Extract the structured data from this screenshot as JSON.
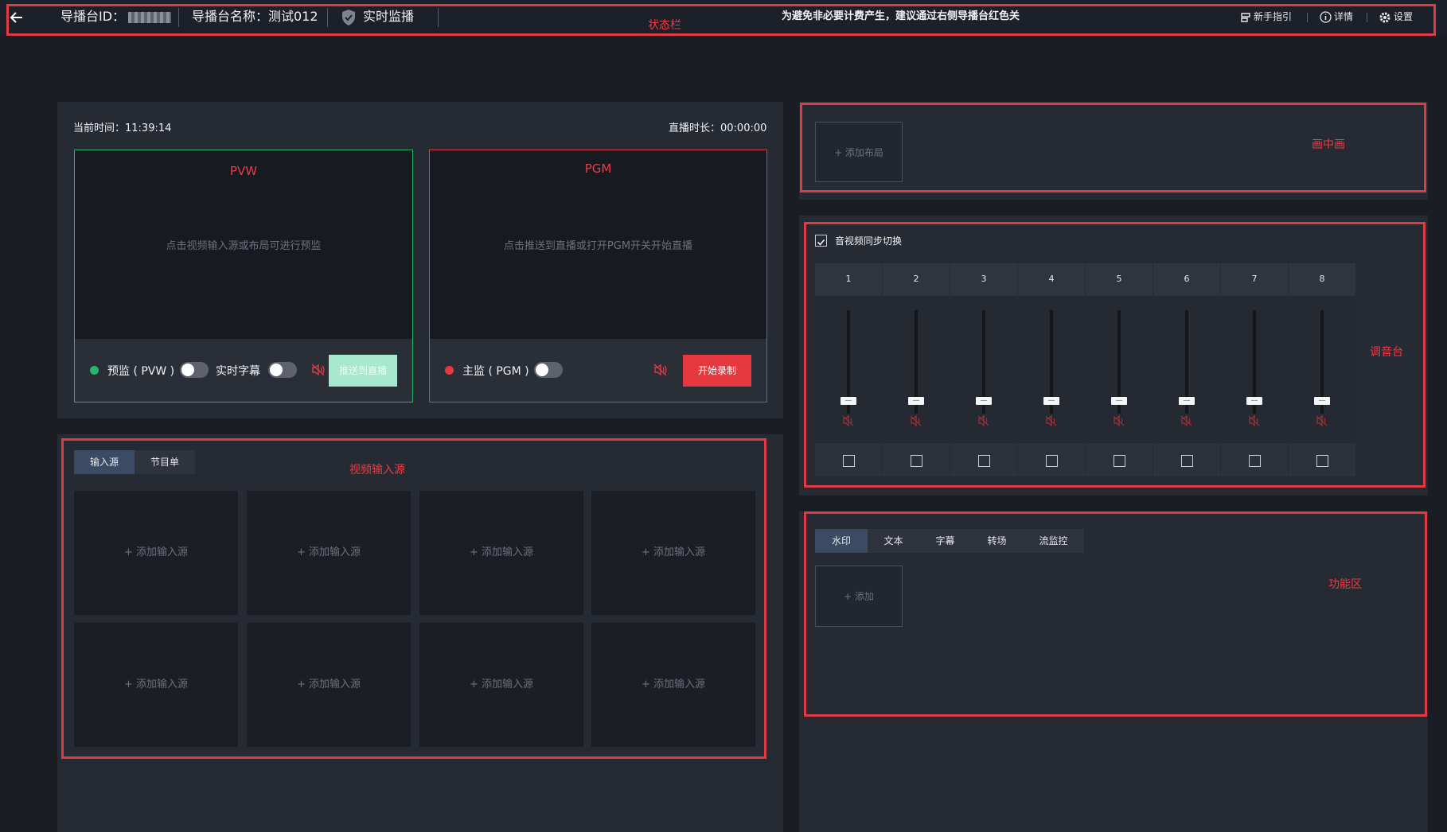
{
  "colors": {
    "accent_red": "#e03a44",
    "accent_green": "#27b56b",
    "pvw_btn": "#a7e8cf",
    "pgm_btn": "#e5393f",
    "tab_active": "#3b4b64"
  },
  "topbar": {
    "back_icon": "arrow-left-icon",
    "id_label": "导播台ID：",
    "name_label": "导播台名称：测试012",
    "monitor_label": "实时监播",
    "notice": "为避免非必要计费产生，建议通过右侧导播台红色关",
    "guide": "新手指引",
    "details": "详情",
    "settings": "设置"
  },
  "annotations": {
    "status_bar": "状态栏",
    "pip": "画中画",
    "mixer": "调音台",
    "video_input": "视频输入源",
    "function_area": "功能区"
  },
  "monitor": {
    "current_time": "当前时间：11:39:14",
    "live_duration": "直播时长：00:00:00",
    "pvw": {
      "title": "PVW",
      "hint": "点击视频输入源或布局可进行预监",
      "label": "预监 ( PVW )",
      "subtitle_label": "实时字幕",
      "push_button": "推送到直播"
    },
    "pgm": {
      "title": "PGM",
      "hint": "点击推送到直播或打开PGM开关开始直播",
      "label": "主监 ( PGM )",
      "record_button": "开始录制"
    }
  },
  "inputs": {
    "tabs": [
      "输入源",
      "节目单"
    ],
    "cells": [
      "+ 添加输入源",
      "+ 添加输入源",
      "+ 添加输入源",
      "+ 添加输入源",
      "+ 添加输入源",
      "+ 添加输入源",
      "+ 添加输入源",
      "+ 添加输入源"
    ]
  },
  "pip": {
    "add_layout": "+ 添加布局"
  },
  "mixer": {
    "sync_label": "音视频同步切换",
    "channels": [
      "1",
      "2",
      "3",
      "4",
      "5",
      "6",
      "7",
      "8"
    ]
  },
  "functions": {
    "tabs": [
      "水印",
      "文本",
      "字幕",
      "转场",
      "流监控"
    ],
    "add": "+ 添加"
  }
}
